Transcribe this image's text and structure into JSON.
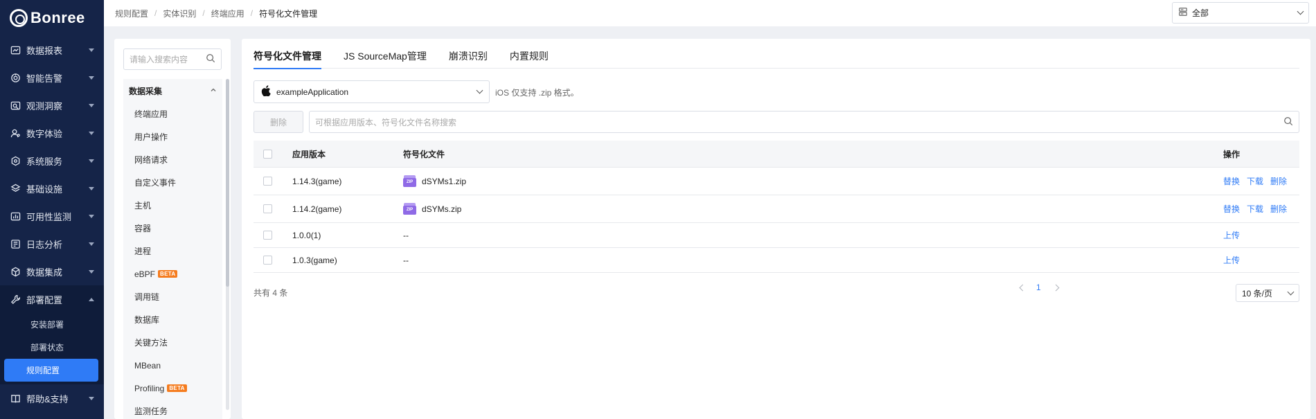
{
  "brand": {
    "name": "Bonree"
  },
  "nav": {
    "items": [
      {
        "label": "数据报表",
        "icon": "chart-icon"
      },
      {
        "label": "智能告警",
        "icon": "alarm-icon"
      },
      {
        "label": "观测洞察",
        "icon": "insight-icon"
      },
      {
        "label": "数字体验",
        "icon": "user-experience-icon"
      },
      {
        "label": "系统服务",
        "icon": "service-icon"
      },
      {
        "label": "基础设施",
        "icon": "infrastructure-icon"
      },
      {
        "label": "可用性监测",
        "icon": "availability-icon"
      },
      {
        "label": "日志分析",
        "icon": "log-icon"
      },
      {
        "label": "数据集成",
        "icon": "integration-icon"
      }
    ],
    "deploy": {
      "label": "部署配置",
      "subitems": [
        "安装部署",
        "部署状态",
        "规则配置"
      ],
      "active": "规则配置"
    },
    "help": {
      "label": "帮助&支持"
    }
  },
  "breadcrumb": [
    "规则配置",
    "实体识别",
    "终端应用",
    "符号化文件管理"
  ],
  "scope_select": {
    "value": "全部"
  },
  "tree": {
    "search_placeholder": "请输入搜索内容",
    "group": "数据采集",
    "items": [
      {
        "label": "终端应用"
      },
      {
        "label": "用户操作"
      },
      {
        "label": "网络请求"
      },
      {
        "label": "自定义事件"
      },
      {
        "label": "主机"
      },
      {
        "label": "容器"
      },
      {
        "label": "进程"
      },
      {
        "label": "eBPF",
        "badge": "BETA"
      },
      {
        "label": "调用链"
      },
      {
        "label": "数据库"
      },
      {
        "label": "关键方法"
      },
      {
        "label": "MBean"
      },
      {
        "label": "Profiling",
        "badge": "BETA"
      },
      {
        "label": "监测任务"
      }
    ]
  },
  "tabs": [
    {
      "label": "符号化文件管理",
      "active": true
    },
    {
      "label": "JS SourceMap管理"
    },
    {
      "label": "崩溃识别"
    },
    {
      "label": "内置规则"
    }
  ],
  "app_select": {
    "value": "exampleApplication",
    "icon": "apple-icon"
  },
  "hint": "iOS 仅支持 .zip 格式。",
  "toolbar": {
    "delete_label": "删除",
    "search_placeholder": "可根据应用版本、符号化文件名称搜索"
  },
  "table": {
    "headers": {
      "version": "应用版本",
      "file": "符号化文件",
      "ops": "操作"
    },
    "rows": [
      {
        "version": "1.14.3(game)",
        "file": "dSYMs1.zip",
        "ops": [
          "替换",
          "下载",
          "删除"
        ]
      },
      {
        "version": "1.14.2(game)",
        "file": "dSYMs.zip",
        "ops": [
          "替换",
          "下载",
          "删除"
        ]
      },
      {
        "version": "1.0.0(1)",
        "file": "--",
        "ops": [
          "上传"
        ]
      },
      {
        "version": "1.0.3(game)",
        "file": "--",
        "ops": [
          "上传"
        ]
      }
    ]
  },
  "pagination": {
    "total": "共有 4 条",
    "current_page": "1",
    "page_size": "10 条/页"
  },
  "colors": {
    "nav_bg": "#152448",
    "accent": "#2f7bf6",
    "beta": "#f57c1f",
    "zip": "#8f6ae6"
  }
}
